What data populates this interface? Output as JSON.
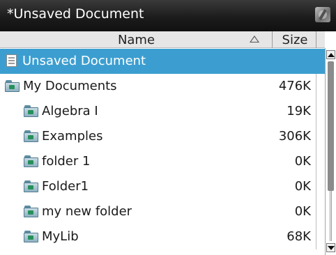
{
  "window": {
    "title": "*Unsaved Document",
    "status_icon": "battery-icon"
  },
  "columns": {
    "name_label": "Name",
    "size_label": "Size",
    "sort_icon": "sort-ascending-icon"
  },
  "rows": [
    {
      "label": "Unsaved Document",
      "size": "",
      "icon": "document-icon",
      "selected": true
    },
    {
      "label": "My Documents",
      "size": "476K",
      "icon": "folder-open-icon"
    },
    {
      "label": "Algebra I",
      "size": "19K",
      "icon": "folder-icon"
    },
    {
      "label": "Examples",
      "size": "306K",
      "icon": "folder-icon"
    },
    {
      "label": "folder 1",
      "size": "0K",
      "icon": "folder-icon"
    },
    {
      "label": "Folder1",
      "size": "0K",
      "icon": "folder-icon"
    },
    {
      "label": "my new folder",
      "size": "0K",
      "icon": "folder-icon"
    },
    {
      "label": "MyLib",
      "size": "68K",
      "icon": "folder-icon"
    }
  ],
  "colors": {
    "selection": "#3c9ed0",
    "titlebar": "#1c1c1c",
    "folder_mark": "#27905a"
  }
}
